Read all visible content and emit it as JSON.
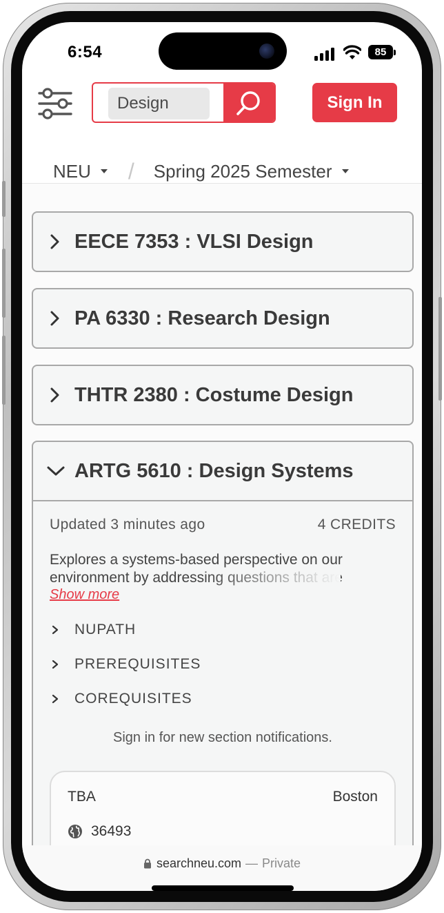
{
  "status_bar": {
    "time": "6:54",
    "battery": "85"
  },
  "header": {
    "search_value": "Design",
    "signin_label": "Sign In",
    "breadcrumb": {
      "school": "NEU",
      "separator": "/",
      "term": "Spring 2025 Semester"
    }
  },
  "courses": [
    {
      "title": "EECE 7353 : VLSI Design"
    },
    {
      "title": "PA 6330 : Research Design"
    },
    {
      "title": "THTR 2380 : Costume Design"
    },
    {
      "title": "ARTG 5610 : Design Systems",
      "updated": "Updated 3 minutes ago",
      "credits": "4 CREDITS",
      "description_line1": "Explores a systems-based perspective on our",
      "description_line2": "environment by addressing questions that are",
      "show_more": "Show more",
      "sections": [
        "NUPATH",
        "PREREQUISITES",
        "COREQUISITES"
      ],
      "notify_text": "Sign in for new section notifications.",
      "section": {
        "time": "TBA",
        "campus": "Boston",
        "crn": "36493"
      }
    }
  ],
  "browser": {
    "domain": "searchneu.com",
    "dash": "—",
    "mode": "Private"
  },
  "colors": {
    "accent": "#e63b47",
    "card_border": "#a8a8a8"
  },
  "icons": [
    "filter-icon",
    "search-icon",
    "chevron-right-icon",
    "chevron-down-icon",
    "globe-icon",
    "lock-icon",
    "wifi-icon",
    "signal-icon",
    "battery-icon"
  ]
}
